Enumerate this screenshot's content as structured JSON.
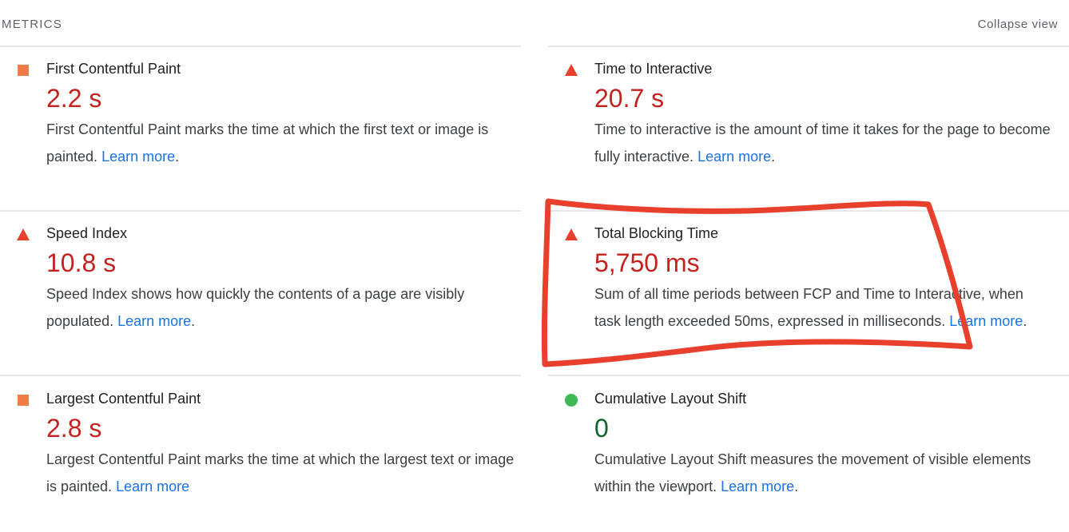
{
  "header": {
    "title": "METRICS",
    "collapse_label": "Collapse view"
  },
  "metrics": [
    {
      "name": "First Contentful Paint",
      "value": "2.2 s",
      "description": "First Contentful Paint marks the time at which the first text or image is painted.",
      "link": "Learn more",
      "trail": ".",
      "status": "average",
      "icon": "orange-square-icon",
      "color": "#f07c4a"
    },
    {
      "name": "Time to Interactive",
      "value": "20.7 s",
      "description": "Time to interactive is the amount of time it takes for the page to become fully interactive.",
      "link": "Learn more",
      "trail": ".",
      "status": "fail",
      "icon": "red-triangle-icon",
      "color": "#e8402c"
    },
    {
      "name": "Speed Index",
      "value": "10.8 s",
      "description": "Speed Index shows how quickly the contents of a page are visibly populated.",
      "link": "Learn more",
      "trail": ".",
      "status": "fail",
      "icon": "red-triangle-icon",
      "color": "#e8402c"
    },
    {
      "name": "Total Blocking Time",
      "value": "5,750 ms",
      "description": "Sum of all time periods between FCP and Time to Interactive, when task length exceeded 50ms, expressed in milliseconds.",
      "link": "Learn more",
      "trail": ".",
      "status": "fail",
      "icon": "red-triangle-icon",
      "color": "#e8402c"
    },
    {
      "name": "Largest Contentful Paint",
      "value": "2.8 s",
      "description": "Largest Contentful Paint marks the time at which the largest text or image is painted.",
      "link": "Learn more",
      "trail": "",
      "status": "average",
      "icon": "orange-square-icon",
      "color": "#f07c4a"
    },
    {
      "name": "Cumulative Layout Shift",
      "value": "0",
      "description": "Cumulative Layout Shift measures the movement of visible elements within the viewport.",
      "link": "Learn more",
      "trail": ".",
      "status": "pass",
      "icon": "green-circle-icon",
      "color": "#3dba57"
    }
  ],
  "annotation": {
    "shape": "hand-drawn highlight box",
    "color": "#e8402c",
    "target": "Total Blocking Time"
  }
}
